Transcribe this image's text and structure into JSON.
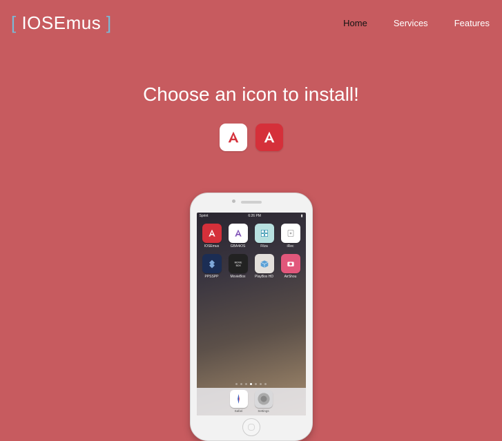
{
  "brand": {
    "name": "IOSEmus"
  },
  "nav": {
    "items": [
      {
        "label": "Home",
        "active": true
      },
      {
        "label": "Services",
        "active": false
      },
      {
        "label": "Features",
        "active": false
      }
    ]
  },
  "main": {
    "headline": "Choose an icon to install!",
    "install_icons": [
      {
        "name": "iosemus-white",
        "bg": "white"
      },
      {
        "name": "iosemus-red",
        "bg": "red"
      }
    ]
  },
  "phone": {
    "statusbar": {
      "carrier": "Sprint",
      "time": "6:26 PM"
    },
    "apps_row1": [
      {
        "label": "IOSEmus",
        "tile": "tile-red"
      },
      {
        "label": "GBA4iOS",
        "tile": "tile-white"
      },
      {
        "label": "Filza",
        "tile": "tile-teal"
      },
      {
        "label": "iRec",
        "tile": "tile-white"
      }
    ],
    "apps_row2": [
      {
        "label": "PPSSPP",
        "tile": "tile-blue"
      },
      {
        "label": "MovieBox",
        "tile": "tile-dark"
      },
      {
        "label": "PlayBox HD",
        "tile": "tile-light"
      },
      {
        "label": "AirShou",
        "tile": "tile-pink"
      }
    ],
    "dock": [
      {
        "label": "Safari",
        "kind": "safari"
      },
      {
        "label": "Settings",
        "kind": "settings"
      }
    ]
  }
}
